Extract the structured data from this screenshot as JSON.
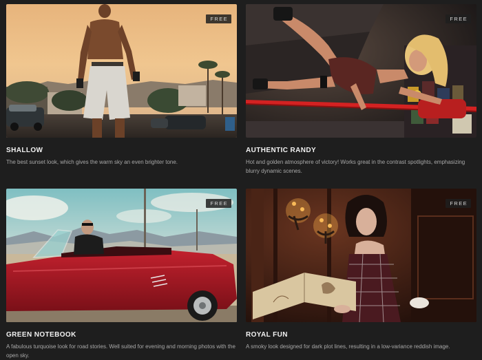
{
  "presets": [
    {
      "title": "SHALLOW",
      "badge": "FREE",
      "description": "The best sunset look, which gives the warm sky an even brighter tone."
    },
    {
      "title": "AUTHENTIC RANDY",
      "badge": "FREE",
      "description": "Hot and golden atmosphere of victory! Works great in the contrast spotlights, emphasizing blurry dynamic scenes."
    },
    {
      "title": "GREEN NOTEBOOK",
      "badge": "FREE",
      "description": "A fabulous turquoise look for road stories. Well suited for evening and morning photos with the open sky."
    },
    {
      "title": "ROYAL FUN",
      "badge": "FREE",
      "description": "A smoky look designed for dark plot lines, resulting in a low-variance reddish image."
    }
  ]
}
